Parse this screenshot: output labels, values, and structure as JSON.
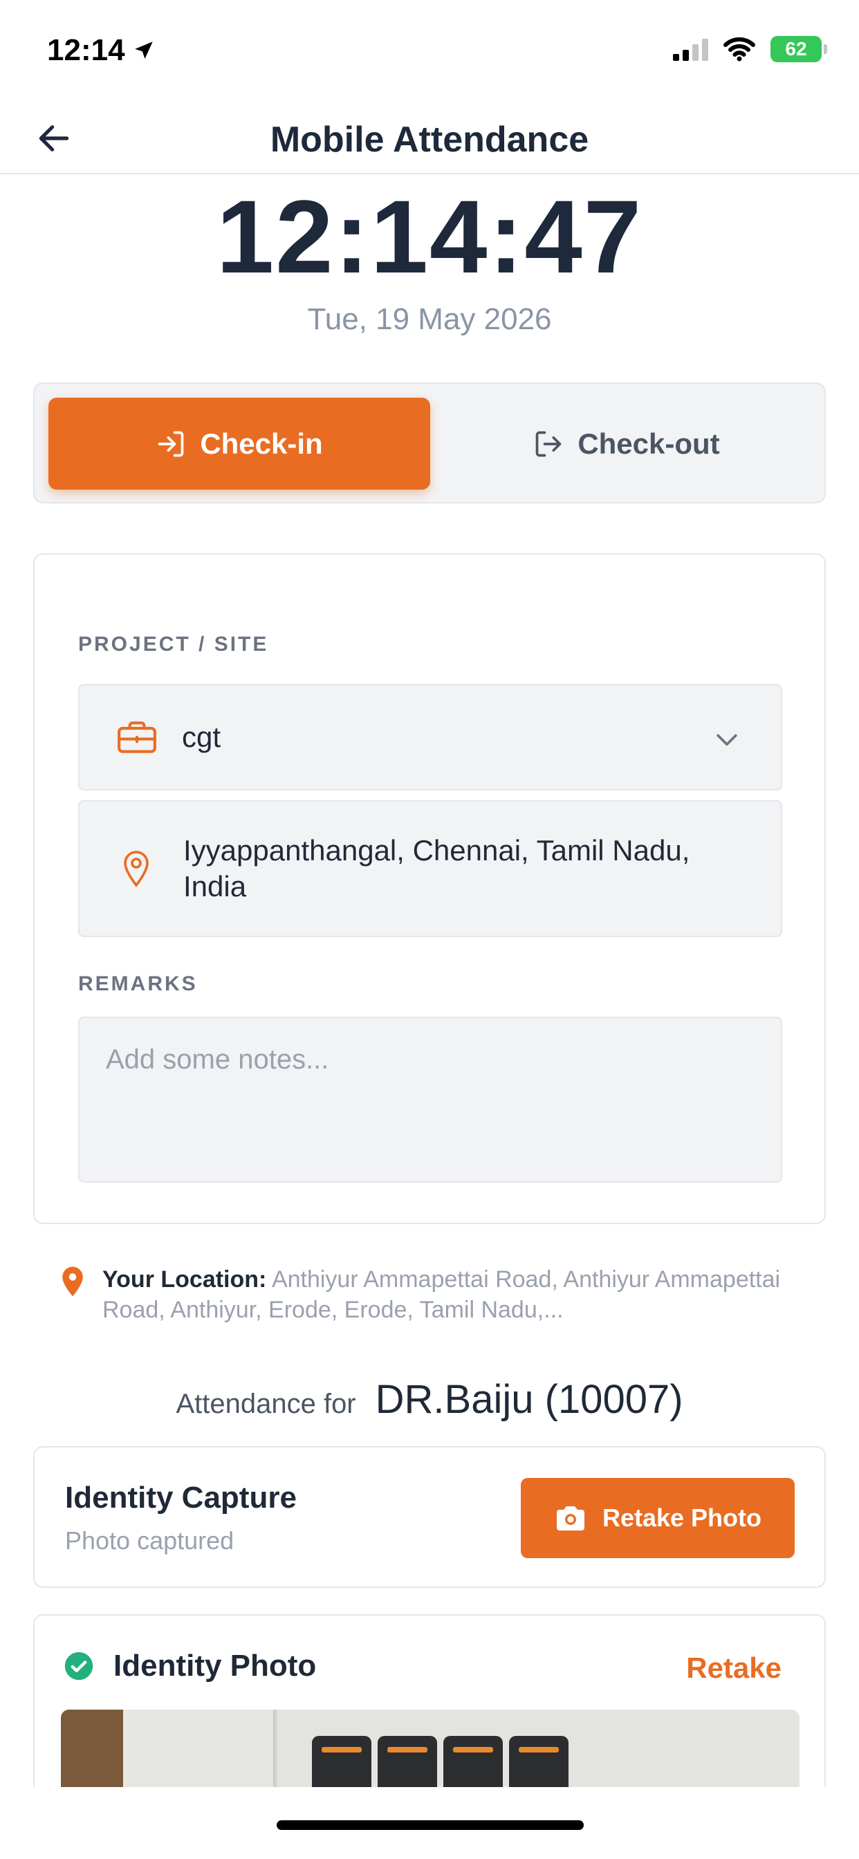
{
  "status_bar": {
    "time": "12:14",
    "battery": "62"
  },
  "header": {
    "title": "Mobile Attendance"
  },
  "clock": {
    "time": "12:14:47",
    "date": "Tue, 19 May 2026"
  },
  "mode_toggle": {
    "check_in_label": "Check-in",
    "check_out_label": "Check-out",
    "selected": "Check-in"
  },
  "form": {
    "project_label": "PROJECT / SITE",
    "project_value": "cgt",
    "site_location": "Iyyappanthangal, Chennai, Tamil Nadu, India",
    "remarks_label": "REMARKS",
    "remarks_placeholder": "Add some notes..."
  },
  "your_location": {
    "label": "Your Location:",
    "value": "Anthiyur Ammapettai Road, Anthiyur Ammapettai Road, Anthiyur, Erode, Erode, Tamil Nadu,..."
  },
  "attendance_for": {
    "label": "Attendance for",
    "name": "DR.Baiju (10007)"
  },
  "identity_capture": {
    "title": "Identity Capture",
    "subtitle": "Photo captured",
    "button_label": "Retake Photo"
  },
  "identity_photo": {
    "title": "Identity Photo",
    "retake_label": "Retake"
  },
  "colors": {
    "accent": "#e86d23",
    "success": "#22b07d",
    "text_dark": "#1e293b",
    "text_muted": "#9aa1ad"
  },
  "icons": [
    "location-arrow-icon",
    "signal-icon",
    "wifi-icon",
    "battery-icon",
    "back-arrow-icon",
    "check-in-icon",
    "check-out-icon",
    "briefcase-icon",
    "chevron-down-icon",
    "map-pin-icon",
    "camera-icon",
    "check-circle-icon"
  ]
}
